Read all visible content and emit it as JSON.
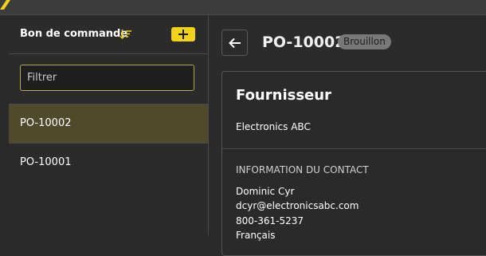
{
  "sidebar": {
    "title": "Bon de commande",
    "add_label": "+",
    "filter_placeholder": "Filtrer",
    "items": [
      {
        "label": "PO-10002",
        "selected": true
      },
      {
        "label": "PO-10001",
        "selected": false
      }
    ]
  },
  "detail": {
    "po_number": "PO-10002",
    "status": "Brouillon",
    "supplier_heading": "Fournisseur",
    "supplier_name": "Electronics ABC",
    "contact_heading": "INFORMATION DU CONTACT",
    "contact_lines": [
      "Dominic Cyr",
      "dcyr@electronicsabc.com",
      "800-361-5237",
      "Français"
    ]
  },
  "colors": {
    "accent": "#f2d21b",
    "selected_row": "#4f4a2c",
    "background": "#2b2b2b",
    "badge": "#787878"
  },
  "icons": [
    "sort-icon",
    "plus-icon",
    "arrow-left-icon"
  ]
}
